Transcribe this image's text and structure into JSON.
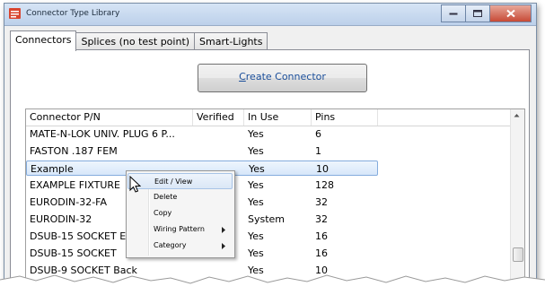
{
  "window": {
    "title": "Connector Type Library"
  },
  "tabs": [
    {
      "label": "Connectors",
      "active": true
    },
    {
      "label": "Splices (no test point)",
      "active": false
    },
    {
      "label": "Smart-Lights",
      "active": false
    }
  ],
  "create_button": {
    "mnemonic": "C",
    "rest": "reate Connector"
  },
  "grid": {
    "columns": [
      "Connector P/N",
      "Verified",
      "In Use",
      "Pins"
    ],
    "rows": [
      {
        "pn": "MATE-N-LOK UNIV. PLUG 6 P...",
        "verified": "",
        "in_use": "Yes",
        "pins": "6"
      },
      {
        "pn": "FASTON .187 FEM",
        "verified": "",
        "in_use": "Yes",
        "pins": "1"
      },
      {
        "pn": "Example",
        "verified": "",
        "in_use": "Yes",
        "pins": "10",
        "selected": true
      },
      {
        "pn": "EXAMPLE FIXTURE",
        "verified": "",
        "in_use": "Yes",
        "pins": "128"
      },
      {
        "pn": "EURODIN-32-FA",
        "verified": "",
        "in_use": "Yes",
        "pins": "32"
      },
      {
        "pn": "EURODIN-32",
        "verified": "",
        "in_use": "System",
        "pins": "32"
      },
      {
        "pn": "DSUB-15 SOCKET E",
        "verified": "",
        "in_use": "Yes",
        "pins": "16"
      },
      {
        "pn": "DSUB-15 SOCKET",
        "verified": "",
        "in_use": "Yes",
        "pins": "16"
      },
      {
        "pn": "DSUB-9 SOCKET Back",
        "verified": "",
        "in_use": "Yes",
        "pins": "10"
      }
    ]
  },
  "context_menu": {
    "items": [
      {
        "label": "Edit / View",
        "submenu": false,
        "hover": true
      },
      {
        "label": "Delete",
        "submenu": false
      },
      {
        "label": "Copy",
        "submenu": false
      },
      {
        "label": "Wiring Pattern",
        "submenu": true
      },
      {
        "label": "Category",
        "submenu": true
      }
    ]
  },
  "colors": {
    "link_blue": "#1a4e9a",
    "selection": "#d7e7fa",
    "close_red": "#c74a36"
  },
  "icons": [
    "app-icon",
    "minimize-icon",
    "maximize-icon",
    "close-icon",
    "scroll-up-icon",
    "submenu-arrow-icon",
    "mouse-cursor-icon"
  ]
}
